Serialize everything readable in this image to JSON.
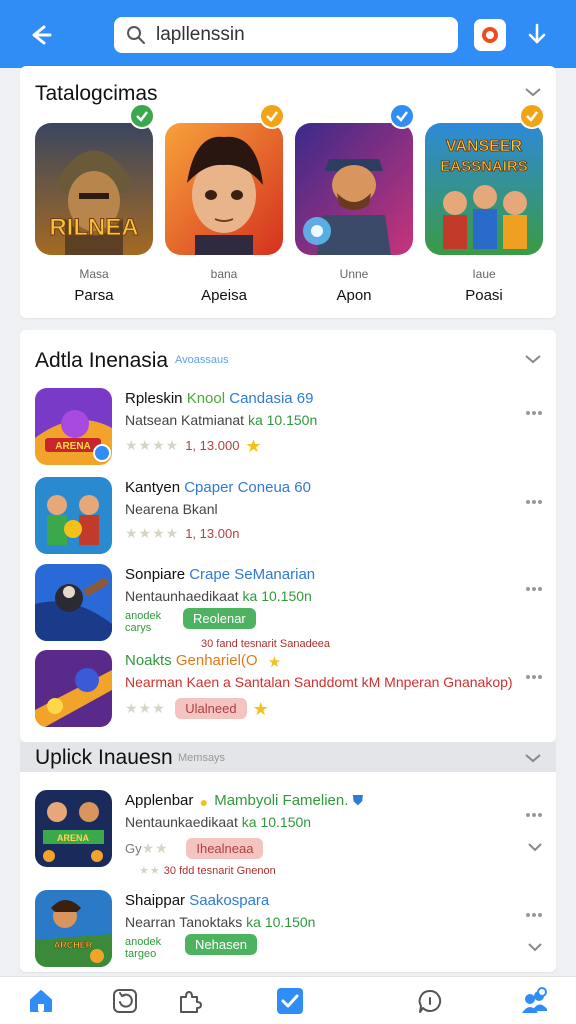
{
  "topbar": {
    "search_value": "lapllenssin"
  },
  "featured": {
    "title": "Tatalogcimas",
    "items": [
      {
        "category": "Masa",
        "name": "Parsa",
        "art_text": "RILNEA",
        "check_color": "#3aa84b"
      },
      {
        "category": "bana",
        "name": "Apeisa",
        "art_text": "",
        "check_color": "#f2a417"
      },
      {
        "category": "Unne",
        "name": "Apon",
        "art_text": "",
        "check_color": "#2f8df5"
      },
      {
        "category": "Iaue",
        "name": "Poasi",
        "art_text": "VANSEER EASSNAIRS",
        "check_color": "#f2a417"
      }
    ]
  },
  "apps": {
    "title": "Adtla Inenasia",
    "subtitle": "Avoassaus",
    "rows": [
      {
        "name": "Rpleskin",
        "name2": "Knool",
        "name3": "Candasia 69",
        "sub": "Natsean Katmianat",
        "sub2": "ka 10.150n",
        "size": "1, 13.000"
      },
      {
        "name": "Kantyen",
        "name2": "Cpaper",
        "name3": "Coneua 60",
        "sub": "Nearena Bkanl",
        "size": "1, 13.00n"
      },
      {
        "name": "Sonpiare",
        "name2": "Crape",
        "name3": "SeManarian",
        "sub": "Nentaunhaedikaat",
        "sub2": "ka 10.150n",
        "green_small": "anodek\ncarys",
        "pill": "Reolenar",
        "tiny": "30 fand tesnarit Sanadeea"
      },
      {
        "name": "Noakts",
        "name2": "Genhariel(O",
        "sub": "Nearman Kaen a Santalan Sanddomt kM Mnperan Gnanakop)",
        "pill": "Ulalneed"
      }
    ]
  },
  "updates": {
    "title": "Uplick Inauesn",
    "subtitle": "Memsays",
    "rows": [
      {
        "name": "Applenbar",
        "name2": "Mambyoli Famelien.",
        "sub": "Nentaunkaedikaat",
        "sub2": "ka 10.150n",
        "pill": "Ihealneaa",
        "prefix": "Gy",
        "tiny": "30 fdd tesnarit Gnenon"
      },
      {
        "name": "Shaippar",
        "name2": "Saakospara",
        "sub": "Nearran Tanoktaks",
        "sub2": "ka 10.150n",
        "green_small": "anodek\ntargeo",
        "pill": "Nehasen"
      }
    ]
  },
  "colors": {
    "accent": "#2f8df5",
    "green": "#3aa84b",
    "star": "#f2c21a"
  },
  "bottom_nav_icons": [
    "home-icon",
    "refresh-icon",
    "puzzle-icon",
    "check-icon",
    "chat-icon",
    "people-icon"
  ]
}
